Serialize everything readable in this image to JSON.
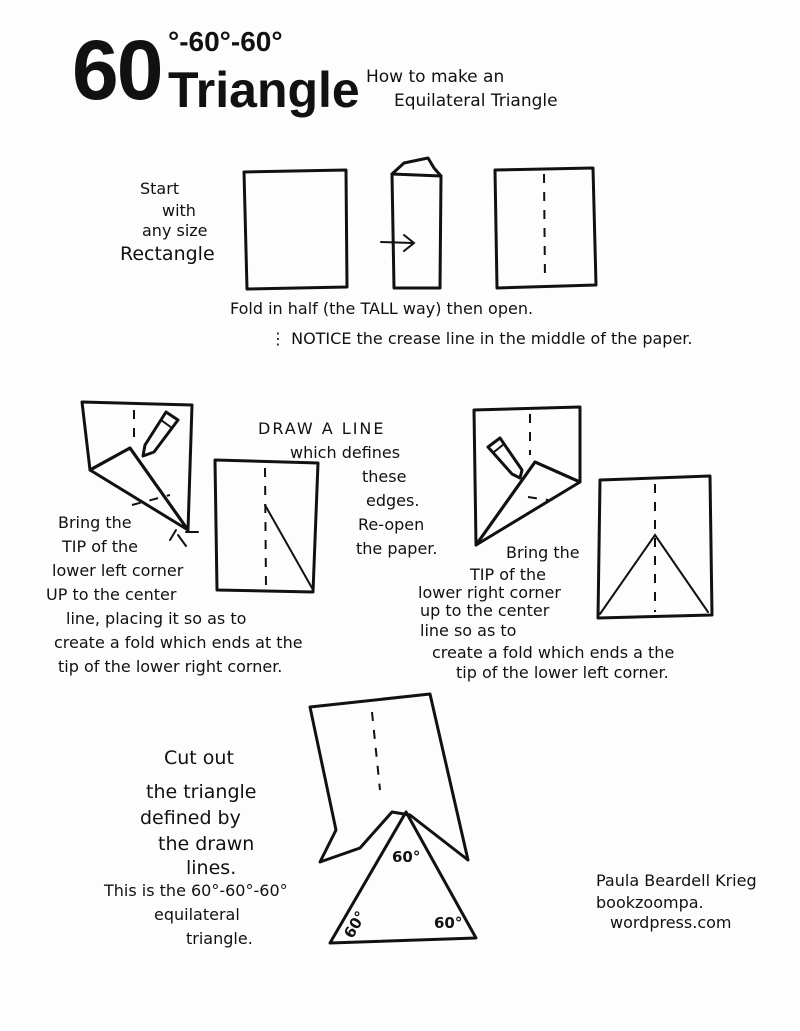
{
  "header": {
    "big_number": "60",
    "superscript": "°-60°-60°",
    "title": "Triangle",
    "subtitle_line1": "How to make an",
    "subtitle_line2": "Equilateral Triangle"
  },
  "step1": {
    "start_lines": [
      "Start",
      "with",
      "any size",
      "Rectangle"
    ],
    "fold_text": "Fold in half (the TALL way) then open.",
    "notice_text": "NOTICE the crease line in the middle of the paper."
  },
  "step2": {
    "left_instruction": [
      "Bring the",
      "TIP of the",
      "lower left corner",
      "UP to the center",
      "line, placing it so as to",
      "create a fold which ends at the",
      "tip of the lower right corner."
    ],
    "draw_line": [
      "DRAW A LINE",
      "which defines",
      "these",
      "edges.",
      "Re-open",
      "the paper."
    ],
    "right_instruction": [
      "Bring the",
      "TIP of the",
      "lower right corner",
      "up to the center",
      "line so as to",
      "create a fold which ends a the",
      "tip of the lower left corner."
    ]
  },
  "step3": {
    "cut_text": [
      "Cut out",
      "the triangle",
      "defined by",
      "the drawn",
      "lines.",
      "This is the 60°-60°-60°",
      "equilateral",
      "triangle."
    ],
    "angle_labels": [
      "60°",
      "60°",
      "60°"
    ]
  },
  "credit": {
    "author": "Paula Beardell Krieg",
    "site_line1": "bookzoompa.",
    "site_line2": "wordpress.com"
  }
}
